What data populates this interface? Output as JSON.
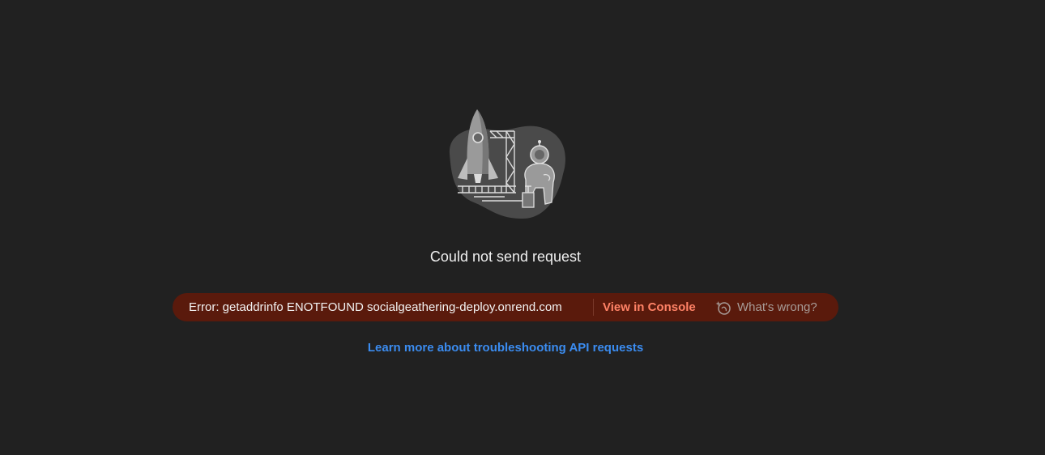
{
  "state": {
    "title": "Could not send request",
    "illustration_icon": "rocket-astronaut-illustration"
  },
  "error": {
    "message": "Error: getaddrinfo ENOTFOUND socialgeathering-deploy.onrend.com",
    "view_console_label": "View in Console",
    "whats_wrong_label": "What's wrong?",
    "whats_wrong_icon": "ai-sparkle-icon"
  },
  "help": {
    "learn_more_label": "Learn more about troubleshooting API requests"
  },
  "colors": {
    "background": "#212121",
    "error_pill": "#5a1a0c",
    "console_link": "#ff8266",
    "help_link": "#3b8cf0"
  }
}
